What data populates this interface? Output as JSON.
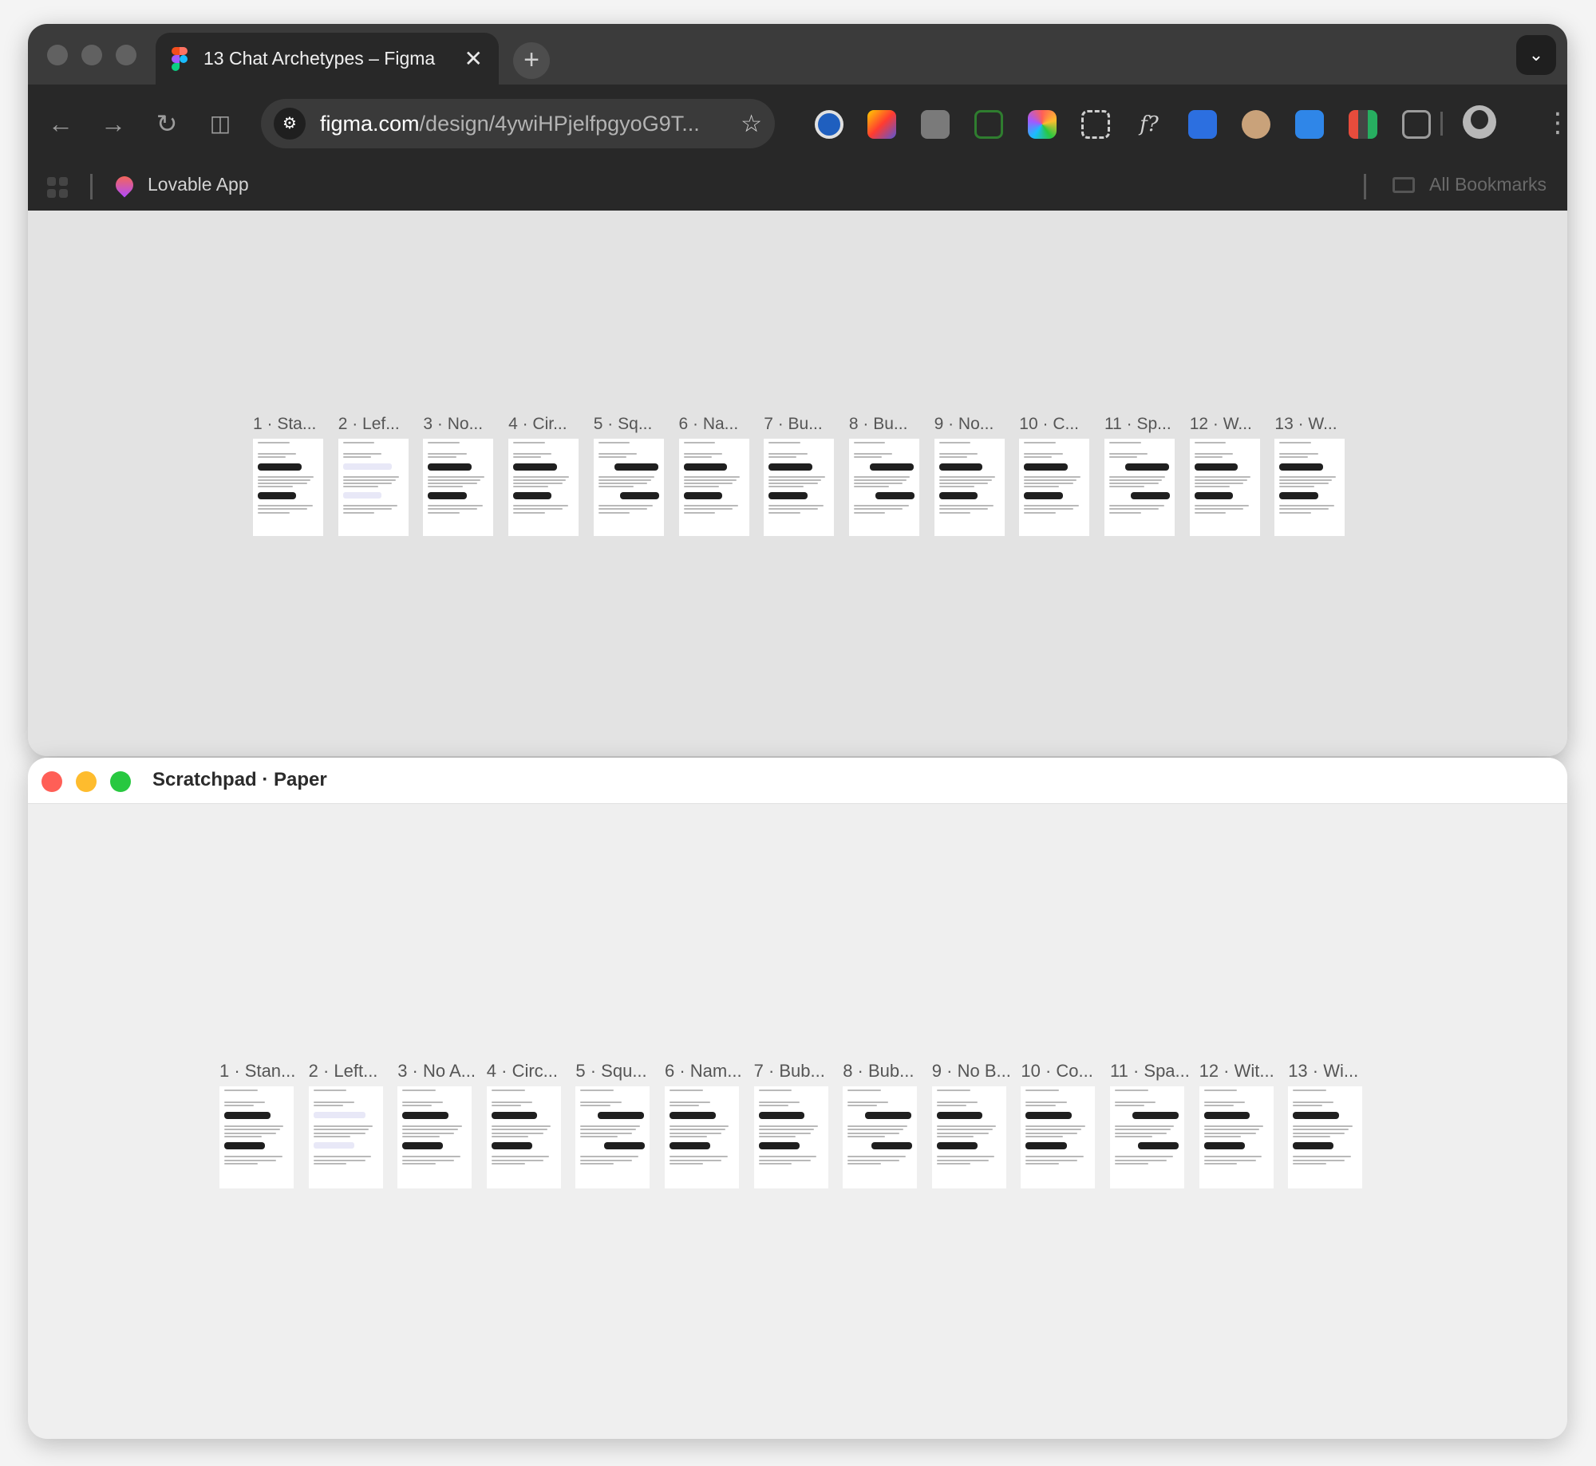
{
  "browser": {
    "tab_title": "13 Chat Archetypes – Figma",
    "tab_close": "✕",
    "new_tab": "+",
    "tab_menu": "⌄",
    "url_host": "figma.com",
    "url_path": "/design/4ywiHPjelfpgyoG9T...",
    "bookmark_label": "Lovable App",
    "all_bookmarks": "All Bookmarks"
  },
  "paper": {
    "title": "Scratchpad · Paper"
  },
  "figma_frames": [
    "1 · Sta...",
    "2 · Lef...",
    "3 · No...",
    "4 · Cir...",
    "5 · Sq...",
    "6 · Na...",
    "7 · Bu...",
    "8 · Bu...",
    "9 · No...",
    "10 · C...",
    "11 · Sp...",
    "12 · W...",
    "13 · W..."
  ],
  "paper_frames": [
    "1 · Stan...",
    "2 · Left...",
    "3 · No A...",
    "4 · Circ...",
    "5 · Squ...",
    "6 · Nam...",
    "7 · Bub...",
    "8 · Bub...",
    "9 · No B...",
    "10 · Co...",
    "11 · Spa...",
    "12 · Wit...",
    "13 · Wi..."
  ],
  "colors": {
    "mac_close": "#ff5f57",
    "mac_min": "#febc2e",
    "mac_max": "#28c840",
    "dark_bubble": "#1f1f1f",
    "light_bubble": "#e8e8f7"
  },
  "icons": {
    "back": "arrow-left-icon",
    "forward": "arrow-right-icon",
    "reload": "reload-icon",
    "split": "split-view-icon",
    "site_info": "tune-icon",
    "bookmark_star": "star-icon",
    "menu": "kebab-icon"
  }
}
